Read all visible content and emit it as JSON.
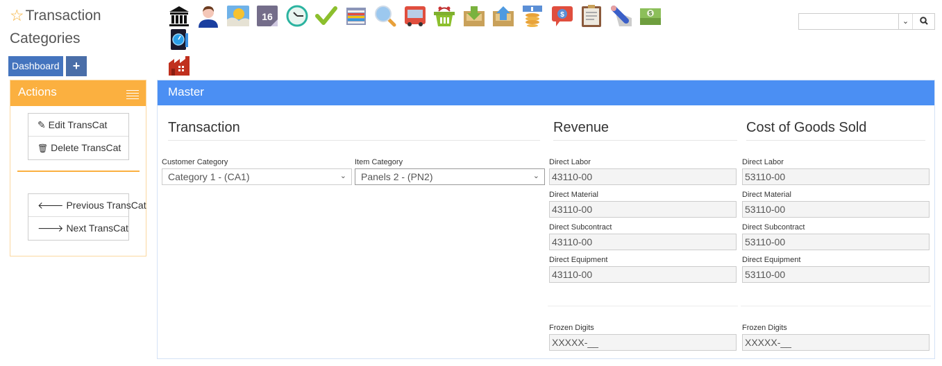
{
  "page": {
    "title": "Transaction Categories",
    "title_icon": "star-outline-icon"
  },
  "nav": {
    "dashboard_label": "Dashboard",
    "add_label": "+"
  },
  "toolbar": {
    "icons": [
      "bank-icon",
      "user-icon",
      "weather-icon",
      "calendar-icon",
      "clock-icon",
      "checkmark-icon",
      "spreadsheet-icon",
      "magnifier-icon",
      "bus-icon",
      "basket-icon",
      "inbox-download-icon",
      "inbox-upload-icon",
      "coins-icon",
      "dollar-chat-icon",
      "clipboard-icon",
      "pencil-icon",
      "money-icon",
      "dashboard-app-icon",
      "factory-icon"
    ],
    "calendar_day": "16"
  },
  "search": {
    "value": "",
    "placeholder": ""
  },
  "actions": {
    "title": "Actions",
    "group1": [
      {
        "label": "Edit TransCat",
        "icon": "pencil-icon"
      },
      {
        "label": "Delete TransCat",
        "icon": "trash-icon"
      }
    ],
    "group2": [
      {
        "label": "Previous TransCat",
        "icon": "arrow-left-icon"
      },
      {
        "label": "Next TransCat",
        "icon": "arrow-right-icon"
      }
    ]
  },
  "master": {
    "title": "Master",
    "transaction": {
      "title": "Transaction",
      "customer_category_label": "Customer Category",
      "customer_category_value": "Category 1 - (CA1)",
      "item_category_label": "Item Category",
      "item_category_value": "Panels 2 - (PN2)"
    },
    "revenue": {
      "title": "Revenue",
      "fields": [
        {
          "label": "Direct Labor",
          "value": "43110-00"
        },
        {
          "label": "Direct Material",
          "value": "43110-00"
        },
        {
          "label": "Direct Subcontract",
          "value": "43110-00"
        },
        {
          "label": "Direct Equipment",
          "value": "43110-00"
        }
      ],
      "frozen_label": "Frozen Digits",
      "frozen_value": "XXXXX-__"
    },
    "cogs": {
      "title": "Cost of Goods Sold",
      "fields": [
        {
          "label": "Direct Labor",
          "value": "53110-00"
        },
        {
          "label": "Direct Material",
          "value": "53110-00"
        },
        {
          "label": "Direct Subcontract",
          "value": "53110-00"
        },
        {
          "label": "Direct Equipment",
          "value": "53110-00"
        }
      ],
      "frozen_label": "Frozen Digits",
      "frozen_value": "XXXXX-__"
    }
  }
}
